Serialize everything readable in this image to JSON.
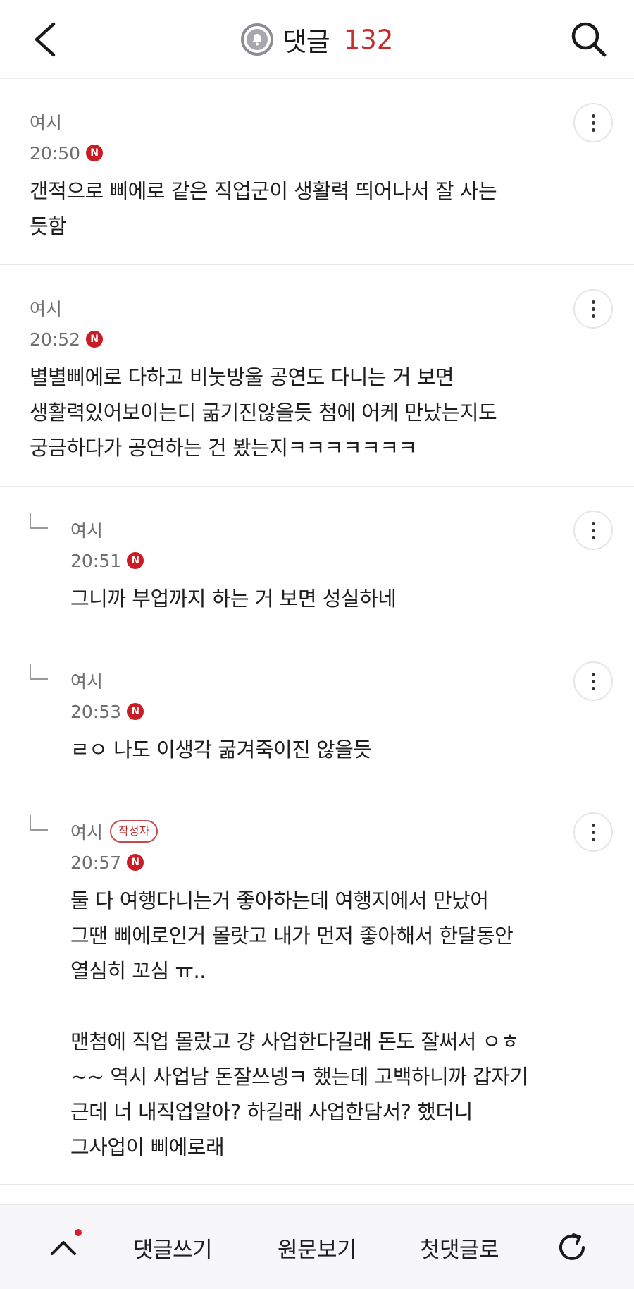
{
  "header": {
    "title": "댓글",
    "count": "132",
    "back_icon": "chevron-left-icon",
    "search_icon": "search-icon",
    "title_icon": "bell-icon"
  },
  "comments": [
    {
      "author": "여시",
      "time": "20:50",
      "badge": "N",
      "text": "갠적으로 삐에로 같은 직업군이 생활력 띄어나서 잘 사는\n듯함",
      "reply": false,
      "op": false
    },
    {
      "author": "여시",
      "time": "20:52",
      "badge": "N",
      "text": "별별삐에로 다하고 비눗방울 공연도 다니는 거 보면\n생활력있어보이는디 굶기진않을듯 첨에 어케 만났는지도\n궁금하다가 공연하는 건 봤는지ㅋㅋㅋㅋㅋㅋㅋ",
      "reply": false,
      "op": false
    },
    {
      "author": "여시",
      "time": "20:51",
      "badge": "N",
      "text": "그니까 부업까지 하는 거 보면 성실하네",
      "reply": true,
      "op": false
    },
    {
      "author": "여시",
      "time": "20:53",
      "badge": "N",
      "text": "ㄹㅇ 나도 이생각 굶겨죽이진 않을듯",
      "reply": true,
      "op": false
    },
    {
      "author": "여시",
      "op_label": "작성자",
      "time": "20:57",
      "badge": "N",
      "text": "둘 다 여행다니는거 좋아하는데 여행지에서 만났어\n그땐 삐에로인거 몰랏고 내가 먼저 좋아해서 한달동안\n열심히 꼬심 ㅠ..\n\n맨첨에 직업 몰랐고 걍 사업한다길래 돈도 잘써서 ㅇㅎ\n~~ 역시 사업남 돈잘쓰넹ㅋ 했는데 고백하니까 갑자기\n근데 너 내직업알아? 하길래 사업한담서? 했더니\n그사업이 삐에로래",
      "reply": true,
      "op": true
    }
  ],
  "footer": {
    "up_icon": "chevron-up-icon",
    "write_label": "댓글쓰기",
    "original_label": "원문보기",
    "first_label": "첫댓글로",
    "refresh_icon": "refresh-icon"
  },
  "colors": {
    "accent_red": "#c62c2c",
    "n_badge": "#c81d25"
  }
}
